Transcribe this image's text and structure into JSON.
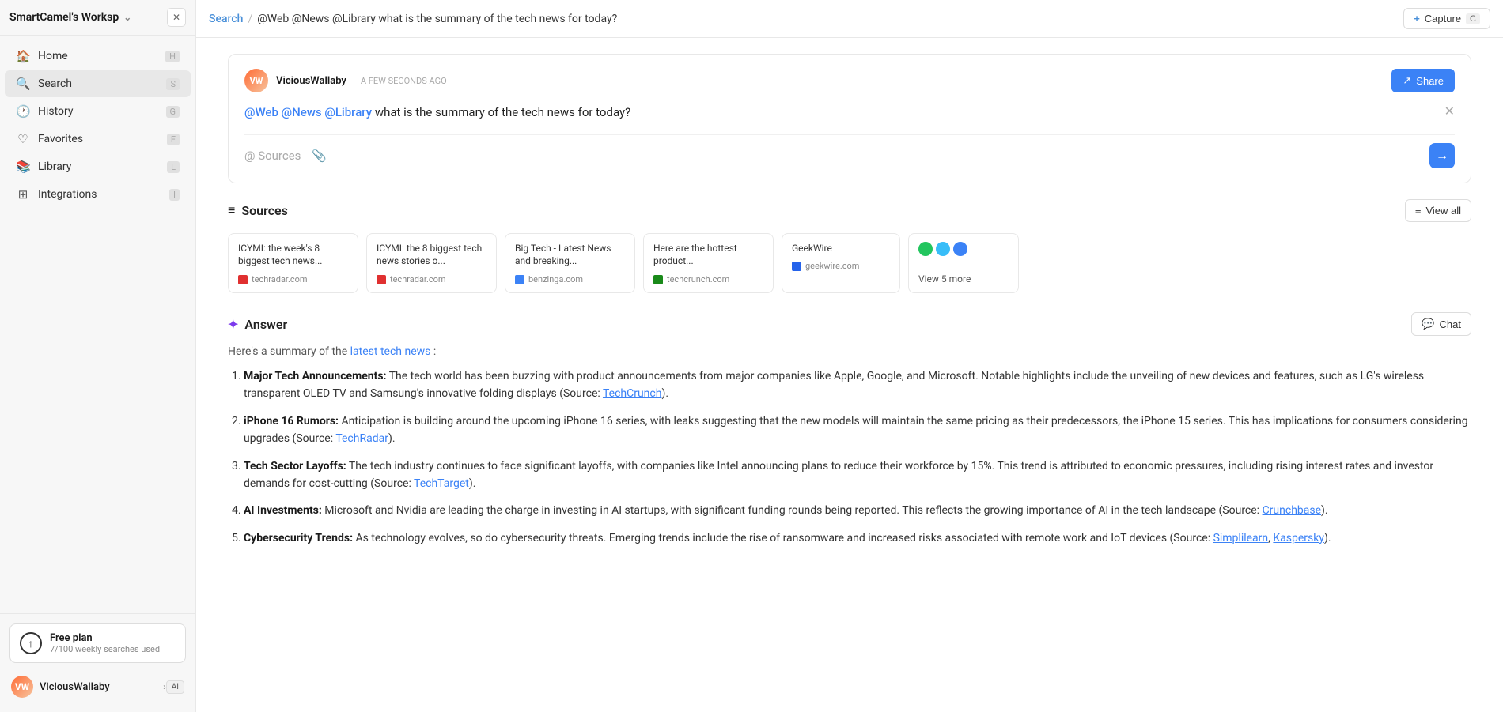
{
  "app": {
    "workspace": "SmartCamel's Worksp",
    "workspace_shortcut": "AI"
  },
  "sidebar": {
    "nav_items": [
      {
        "id": "home",
        "label": "Home",
        "icon": "🏠",
        "shortcut": "H",
        "active": false
      },
      {
        "id": "search",
        "label": "Search",
        "icon": "🔍",
        "shortcut": "S",
        "active": true
      },
      {
        "id": "history",
        "label": "History",
        "icon": "🕐",
        "shortcut": "G",
        "active": false
      },
      {
        "id": "favorites",
        "label": "Favorites",
        "icon": "♡",
        "shortcut": "F",
        "active": false
      },
      {
        "id": "library",
        "label": "Library",
        "icon": "📚",
        "shortcut": "L",
        "active": false
      },
      {
        "id": "integrations",
        "label": "Integrations",
        "icon": "⊞",
        "shortcut": "I",
        "active": false
      }
    ],
    "free_plan": {
      "label": "Free plan",
      "sublabel": "7/100 weekly searches used"
    },
    "user": {
      "name": "ViciousWallaby",
      "avatar_initials": "VW"
    }
  },
  "topbar": {
    "breadcrumb_search": "Search",
    "breadcrumb_sep": "/",
    "breadcrumb_query": "@Web @News @Library what is the summary of the tech news for today?",
    "capture_label": "Capture",
    "capture_shortcut": "C"
  },
  "query_card": {
    "username": "ViciousWallaby",
    "timestamp": "A FEW SECONDS AGO",
    "share_label": "Share",
    "tag_web": "@Web",
    "tag_news": "@News",
    "tag_library": "@Library",
    "query_rest": "what is the summary of the tech news for today?",
    "sources_icon": "@",
    "attach_icon": "📎"
  },
  "sources": {
    "title": "Sources",
    "view_all_label": "View all",
    "items": [
      {
        "title": "ICYMI: the week's 8 biggest tech news...",
        "domain": "techradar.com",
        "favicon_class": "source-favicon-tr"
      },
      {
        "title": "ICYMI: the 8 biggest tech news stories o...",
        "domain": "techradar.com",
        "favicon_class": "source-favicon-tr"
      },
      {
        "title": "Big Tech - Latest News and breaking...",
        "domain": "benzinga.com",
        "favicon_class": "source-favicon-benz"
      },
      {
        "title": "Here are the hottest product...",
        "domain": "techcrunch.com",
        "favicon_class": "source-favicon-tc"
      },
      {
        "title": "GeekWire",
        "domain": "geekwire.com",
        "favicon_class": "source-favicon-gw"
      }
    ],
    "more_label": "View 5 more"
  },
  "answer": {
    "title": "Answer",
    "chat_label": "Chat",
    "intro": "Here's a summary of the latest tech news:",
    "items": [
      {
        "bold": "Major Tech Announcements:",
        "text": " The tech world has been buzzing with product announcements from major companies like Apple, Google, and Microsoft. Notable highlights include the unveiling of new devices and features, such as LG's wireless transparent OLED TV and Samsung's innovative folding displays (Source: ",
        "link": "TechCrunch",
        "link_end": ")."
      },
      {
        "bold": "iPhone 16 Rumors:",
        "text": " Anticipation is building around the upcoming iPhone 16 series, with leaks suggesting that the new models will maintain the same pricing as their predecessors, the iPhone 15 series. This has implications for consumers considering upgrades (Source: ",
        "link": "TechRadar",
        "link_end": ")."
      },
      {
        "bold": "Tech Sector Layoffs:",
        "text": " The tech industry continues to face significant layoffs, with companies like Intel announcing plans to reduce their workforce by 15%. This trend is attributed to economic pressures, including rising interest rates and investor demands for cost-cutting (Source: ",
        "link": "TechTarget",
        "link_end": ")."
      },
      {
        "bold": "AI Investments:",
        "text": " Microsoft and Nvidia are leading the charge in investing in AI startups, with significant funding rounds being reported. This reflects the growing importance of AI in the tech landscape (Source: ",
        "link": "Crunchbase",
        "link_end": ")."
      },
      {
        "bold": "Cybersecurity Trends:",
        "text": " As technology evolves, so do cybersecurity threats. Emerging trends include the rise of ransomware and increased risks associated with remote work and IoT devices (Source: ",
        "link_multi": [
          "Simplilearn",
          "Kaspersky"
        ],
        "link_sep": ", ",
        "link_end": ")."
      }
    ]
  }
}
